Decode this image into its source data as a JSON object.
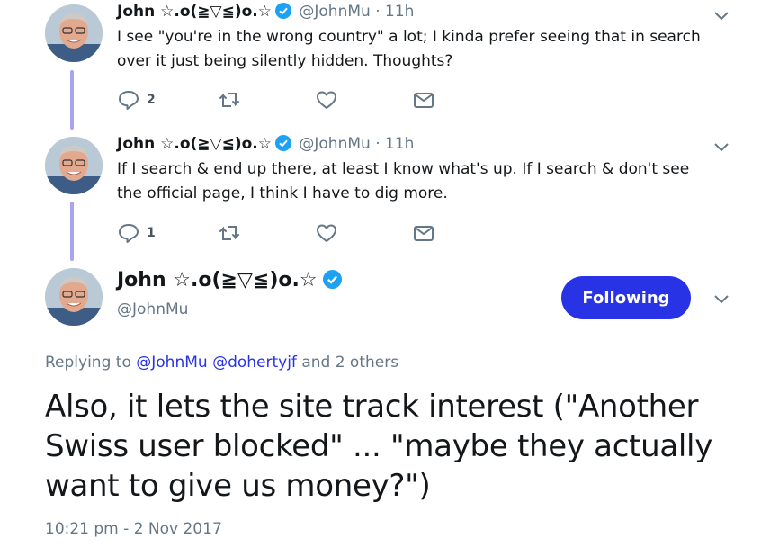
{
  "tweets": [
    {
      "name": "John ☆.o(≧▽≦)o.☆",
      "handle": "@JohnMu",
      "dot": "·",
      "time": "11h",
      "text": "I see \"you're in the wrong country\" a lot; I kinda prefer seeing that in search over it just being silently hidden. Thoughts?",
      "reply_count": "2"
    },
    {
      "name": "John ☆.o(≧▽≦)o.☆",
      "handle": "@JohnMu",
      "dot": "·",
      "time": "11h",
      "text": "If I search & end up there, at least I know what's up. If I search & don't see the official page, I think I have to dig more.",
      "reply_count": "1"
    }
  ],
  "main_tweet": {
    "name": "John ☆.o(≧▽≦)o.☆",
    "handle": "@JohnMu",
    "follow_label": "Following",
    "replying_prefix": "Replying to",
    "mention_1": "@JohnMu",
    "mention_2": "@dohertyjf",
    "replying_suffix": "and 2 others",
    "text": "Also, it lets the site track interest (\"Another Swiss user blocked\" ... \"maybe they actually want to give us money?\")",
    "timestamp": "10:21 pm - 2 Nov 2017"
  },
  "colors": {
    "accent": "#2833e6",
    "thread_line": "#a9a3f0",
    "muted": "#657786",
    "verified": "#1da1f2"
  },
  "icons": [
    "reply-icon",
    "retweet-icon",
    "like-icon",
    "message-icon",
    "chevron-down-icon",
    "verified-badge-icon"
  ]
}
